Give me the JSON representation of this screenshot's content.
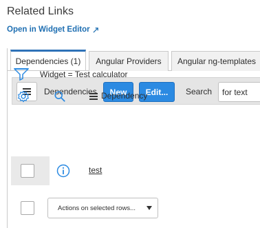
{
  "related_links": {
    "heading": "Related Links",
    "widget_editor_link": "Open in Widget Editor"
  },
  "tabs": [
    {
      "label": "Dependencies (1)",
      "active": true
    },
    {
      "label": "Angular Providers",
      "active": false
    },
    {
      "label": "Angular ng-templates",
      "active": false
    }
  ],
  "toolbar": {
    "title": "Dependencies",
    "new_label": "New",
    "edit_label": "Edit...",
    "search_label": "Search",
    "search_value": "for text"
  },
  "filter": {
    "text": "Widget = Test calculator"
  },
  "list": {
    "column_header": "Dependency",
    "rows": [
      {
        "dependency": "test"
      }
    ],
    "actions_select": "Actions on selected rows..."
  },
  "colors": {
    "accent_blue": "#2b8ae2",
    "link_blue": "#1f6fb2",
    "active_tab_border": "#2e72b8"
  }
}
